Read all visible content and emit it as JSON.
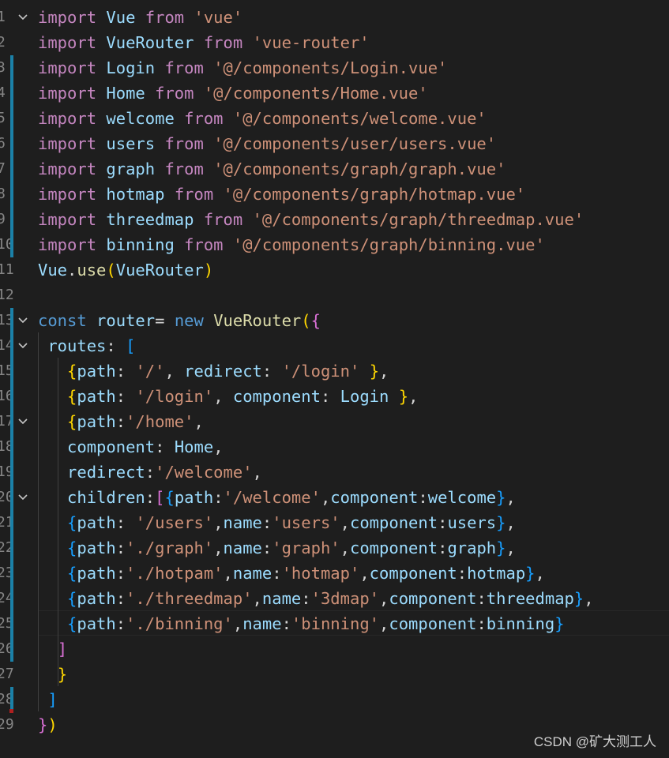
{
  "editor": {
    "lines": [
      {
        "n": "1",
        "fold": true,
        "mark": false,
        "tokens": [
          {
            "t": "import",
            "c": "kw"
          },
          {
            "t": " Vue ",
            "c": "vr"
          },
          {
            "t": "from",
            "c": "kw"
          },
          {
            "t": " ",
            "c": "pu"
          },
          {
            "t": "'vue'",
            "c": "st"
          }
        ]
      },
      {
        "n": "2",
        "fold": false,
        "mark": false,
        "tokens": [
          {
            "t": "import",
            "c": "kw"
          },
          {
            "t": " VueRouter ",
            "c": "vr"
          },
          {
            "t": "from",
            "c": "kw"
          },
          {
            "t": " ",
            "c": "pu"
          },
          {
            "t": "'vue-router'",
            "c": "st"
          }
        ]
      },
      {
        "n": "3",
        "fold": false,
        "mark": true,
        "tokens": [
          {
            "t": "import",
            "c": "kw"
          },
          {
            "t": " Login ",
            "c": "vr"
          },
          {
            "t": "from",
            "c": "kw"
          },
          {
            "t": " ",
            "c": "pu"
          },
          {
            "t": "'@/components/Login.vue'",
            "c": "st"
          }
        ]
      },
      {
        "n": "4",
        "fold": false,
        "mark": true,
        "tokens": [
          {
            "t": "import",
            "c": "kw"
          },
          {
            "t": " Home ",
            "c": "vr"
          },
          {
            "t": "from",
            "c": "kw"
          },
          {
            "t": " ",
            "c": "pu"
          },
          {
            "t": "'@/components/Home.vue'",
            "c": "st"
          }
        ]
      },
      {
        "n": "5",
        "fold": false,
        "mark": true,
        "tokens": [
          {
            "t": "import",
            "c": "kw"
          },
          {
            "t": " welcome ",
            "c": "vr"
          },
          {
            "t": "from",
            "c": "kw"
          },
          {
            "t": " ",
            "c": "pu"
          },
          {
            "t": "'@/components/welcome.vue'",
            "c": "st"
          }
        ]
      },
      {
        "n": "6",
        "fold": false,
        "mark": true,
        "tokens": [
          {
            "t": "import",
            "c": "kw"
          },
          {
            "t": " users ",
            "c": "vr"
          },
          {
            "t": "from",
            "c": "kw"
          },
          {
            "t": " ",
            "c": "pu"
          },
          {
            "t": "'@/components/user/users.vue'",
            "c": "st"
          }
        ]
      },
      {
        "n": "7",
        "fold": false,
        "mark": true,
        "tokens": [
          {
            "t": "import",
            "c": "kw"
          },
          {
            "t": " graph ",
            "c": "vr"
          },
          {
            "t": "from",
            "c": "kw"
          },
          {
            "t": " ",
            "c": "pu"
          },
          {
            "t": "'@/components/graph/graph.vue'",
            "c": "st"
          }
        ]
      },
      {
        "n": "8",
        "fold": false,
        "mark": true,
        "tokens": [
          {
            "t": "import",
            "c": "kw"
          },
          {
            "t": " hotmap ",
            "c": "vr"
          },
          {
            "t": "from",
            "c": "kw"
          },
          {
            "t": " ",
            "c": "pu"
          },
          {
            "t": "'@/components/graph/hotmap.vue'",
            "c": "st"
          }
        ]
      },
      {
        "n": "9",
        "fold": false,
        "mark": true,
        "tokens": [
          {
            "t": "import",
            "c": "kw"
          },
          {
            "t": " threedmap ",
            "c": "vr"
          },
          {
            "t": "from",
            "c": "kw"
          },
          {
            "t": " ",
            "c": "pu"
          },
          {
            "t": "'@/components/graph/threedmap.vue'",
            "c": "st"
          }
        ]
      },
      {
        "n": "10",
        "fold": false,
        "mark": true,
        "tokens": [
          {
            "t": "import",
            "c": "kw"
          },
          {
            "t": " binning ",
            "c": "vr"
          },
          {
            "t": "from",
            "c": "kw"
          },
          {
            "t": " ",
            "c": "pu"
          },
          {
            "t": "'@/components/graph/binning.vue'",
            "c": "st"
          }
        ]
      },
      {
        "n": "11",
        "fold": false,
        "mark": false,
        "tokens": [
          {
            "t": "Vue",
            "c": "vr"
          },
          {
            "t": ".",
            "c": "pu"
          },
          {
            "t": "use",
            "c": "fn"
          },
          {
            "t": "(",
            "c": "br1"
          },
          {
            "t": "VueRouter",
            "c": "vr"
          },
          {
            "t": ")",
            "c": "br1"
          }
        ]
      },
      {
        "n": "12",
        "fold": false,
        "mark": false,
        "tokens": []
      },
      {
        "n": "13",
        "fold": true,
        "mark": true,
        "tokens": [
          {
            "t": "const",
            "c": "kb"
          },
          {
            "t": " router",
            "c": "vr"
          },
          {
            "t": "= ",
            "c": "pu"
          },
          {
            "t": "new",
            "c": "kb"
          },
          {
            "t": " ",
            "c": "pu"
          },
          {
            "t": "VueRouter",
            "c": "fn"
          },
          {
            "t": "(",
            "c": "br1"
          },
          {
            "t": "{",
            "c": "br2"
          }
        ]
      },
      {
        "n": "14",
        "fold": true,
        "mark": true,
        "tokens": [
          {
            "t": " routes",
            "c": "vr"
          },
          {
            "t": ": ",
            "c": "pu"
          },
          {
            "t": "[",
            "c": "br3"
          }
        ]
      },
      {
        "n": "15",
        "fold": false,
        "mark": true,
        "tokens": [
          {
            "t": "   ",
            "c": "pu"
          },
          {
            "t": "{",
            "c": "br1"
          },
          {
            "t": "path",
            "c": "vr"
          },
          {
            "t": ": ",
            "c": "pu"
          },
          {
            "t": "'/'",
            "c": "st"
          },
          {
            "t": ", ",
            "c": "pu"
          },
          {
            "t": "redirect",
            "c": "vr"
          },
          {
            "t": ": ",
            "c": "pu"
          },
          {
            "t": "'/login'",
            "c": "st"
          },
          {
            "t": " ",
            "c": "pu"
          },
          {
            "t": "}",
            "c": "br1"
          },
          {
            "t": ",",
            "c": "pu"
          }
        ]
      },
      {
        "n": "16",
        "fold": false,
        "mark": true,
        "tokens": [
          {
            "t": "   ",
            "c": "pu"
          },
          {
            "t": "{",
            "c": "br1"
          },
          {
            "t": "path",
            "c": "vr"
          },
          {
            "t": ": ",
            "c": "pu"
          },
          {
            "t": "'/login'",
            "c": "st"
          },
          {
            "t": ", ",
            "c": "pu"
          },
          {
            "t": "component",
            "c": "vr"
          },
          {
            "t": ": ",
            "c": "pu"
          },
          {
            "t": "Login",
            "c": "vr"
          },
          {
            "t": " ",
            "c": "pu"
          },
          {
            "t": "}",
            "c": "br1"
          },
          {
            "t": ",",
            "c": "pu"
          }
        ]
      },
      {
        "n": "17",
        "fold": true,
        "mark": true,
        "tokens": [
          {
            "t": "   ",
            "c": "pu"
          },
          {
            "t": "{",
            "c": "br1"
          },
          {
            "t": "path",
            "c": "vr"
          },
          {
            "t": ":",
            "c": "pu"
          },
          {
            "t": "'/home'",
            "c": "st"
          },
          {
            "t": ",",
            "c": "pu"
          }
        ]
      },
      {
        "n": "18",
        "fold": false,
        "mark": true,
        "tokens": [
          {
            "t": "   ",
            "c": "pu"
          },
          {
            "t": "component",
            "c": "vr"
          },
          {
            "t": ": ",
            "c": "pu"
          },
          {
            "t": "Home",
            "c": "vr"
          },
          {
            "t": ",",
            "c": "pu"
          }
        ]
      },
      {
        "n": "19",
        "fold": false,
        "mark": true,
        "tokens": [
          {
            "t": "   ",
            "c": "pu"
          },
          {
            "t": "redirect",
            "c": "vr"
          },
          {
            "t": ":",
            "c": "pu"
          },
          {
            "t": "'/welcome'",
            "c": "st"
          },
          {
            "t": ",",
            "c": "pu"
          }
        ]
      },
      {
        "n": "20",
        "fold": true,
        "mark": true,
        "tokens": [
          {
            "t": "   ",
            "c": "pu"
          },
          {
            "t": "children",
            "c": "vr"
          },
          {
            "t": ":",
            "c": "pu"
          },
          {
            "t": "[",
            "c": "br2"
          },
          {
            "t": "{",
            "c": "br3"
          },
          {
            "t": "path",
            "c": "vr"
          },
          {
            "t": ":",
            "c": "pu"
          },
          {
            "t": "'/welcome'",
            "c": "st"
          },
          {
            "t": ",",
            "c": "pu"
          },
          {
            "t": "component",
            "c": "vr"
          },
          {
            "t": ":",
            "c": "pu"
          },
          {
            "t": "welcome",
            "c": "vr"
          },
          {
            "t": "}",
            "c": "br3"
          },
          {
            "t": ",",
            "c": "pu"
          }
        ]
      },
      {
        "n": "21",
        "fold": false,
        "mark": true,
        "tokens": [
          {
            "t": "   ",
            "c": "pu"
          },
          {
            "t": "{",
            "c": "br3"
          },
          {
            "t": "path",
            "c": "vr"
          },
          {
            "t": ": ",
            "c": "pu"
          },
          {
            "t": "'/users'",
            "c": "st"
          },
          {
            "t": ",",
            "c": "pu"
          },
          {
            "t": "name",
            "c": "vr"
          },
          {
            "t": ":",
            "c": "pu"
          },
          {
            "t": "'users'",
            "c": "st"
          },
          {
            "t": ",",
            "c": "pu"
          },
          {
            "t": "component",
            "c": "vr"
          },
          {
            "t": ":",
            "c": "pu"
          },
          {
            "t": "users",
            "c": "vr"
          },
          {
            "t": "}",
            "c": "br3"
          },
          {
            "t": ",",
            "c": "pu"
          }
        ]
      },
      {
        "n": "22",
        "fold": false,
        "mark": true,
        "tokens": [
          {
            "t": "   ",
            "c": "pu"
          },
          {
            "t": "{",
            "c": "br3"
          },
          {
            "t": "path",
            "c": "vr"
          },
          {
            "t": ":",
            "c": "pu"
          },
          {
            "t": "'./graph'",
            "c": "st"
          },
          {
            "t": ",",
            "c": "pu"
          },
          {
            "t": "name",
            "c": "vr"
          },
          {
            "t": ":",
            "c": "pu"
          },
          {
            "t": "'graph'",
            "c": "st"
          },
          {
            "t": ",",
            "c": "pu"
          },
          {
            "t": "component",
            "c": "vr"
          },
          {
            "t": ":",
            "c": "pu"
          },
          {
            "t": "graph",
            "c": "vr"
          },
          {
            "t": "}",
            "c": "br3"
          },
          {
            "t": ",",
            "c": "pu"
          }
        ]
      },
      {
        "n": "23",
        "fold": false,
        "mark": true,
        "tokens": [
          {
            "t": "   ",
            "c": "pu"
          },
          {
            "t": "{",
            "c": "br3"
          },
          {
            "t": "path",
            "c": "vr"
          },
          {
            "t": ":",
            "c": "pu"
          },
          {
            "t": "'./hotpam'",
            "c": "st"
          },
          {
            "t": ",",
            "c": "pu"
          },
          {
            "t": "name",
            "c": "vr"
          },
          {
            "t": ":",
            "c": "pu"
          },
          {
            "t": "'hotmap'",
            "c": "st"
          },
          {
            "t": ",",
            "c": "pu"
          },
          {
            "t": "component",
            "c": "vr"
          },
          {
            "t": ":",
            "c": "pu"
          },
          {
            "t": "hotmap",
            "c": "vr"
          },
          {
            "t": "}",
            "c": "br3"
          },
          {
            "t": ",",
            "c": "pu"
          }
        ]
      },
      {
        "n": "24",
        "fold": false,
        "mark": true,
        "tokens": [
          {
            "t": "   ",
            "c": "pu"
          },
          {
            "t": "{",
            "c": "br3"
          },
          {
            "t": "path",
            "c": "vr"
          },
          {
            "t": ":",
            "c": "pu"
          },
          {
            "t": "'./threedmap'",
            "c": "st"
          },
          {
            "t": ",",
            "c": "pu"
          },
          {
            "t": "name",
            "c": "vr"
          },
          {
            "t": ":",
            "c": "pu"
          },
          {
            "t": "'3dmap'",
            "c": "st"
          },
          {
            "t": ",",
            "c": "pu"
          },
          {
            "t": "component",
            "c": "vr"
          },
          {
            "t": ":",
            "c": "pu"
          },
          {
            "t": "threedmap",
            "c": "vr"
          },
          {
            "t": "}",
            "c": "br3"
          },
          {
            "t": ",",
            "c": "pu"
          }
        ]
      },
      {
        "n": "25",
        "fold": false,
        "mark": true,
        "tokens": [
          {
            "t": "   ",
            "c": "pu"
          },
          {
            "t": "{",
            "c": "br3"
          },
          {
            "t": "path",
            "c": "vr"
          },
          {
            "t": ":",
            "c": "pu"
          },
          {
            "t": "'./binning'",
            "c": "st"
          },
          {
            "t": ",",
            "c": "pu"
          },
          {
            "t": "name",
            "c": "vr"
          },
          {
            "t": ":",
            "c": "pu"
          },
          {
            "t": "'binning'",
            "c": "st"
          },
          {
            "t": ",",
            "c": "pu"
          },
          {
            "t": "component",
            "c": "vr"
          },
          {
            "t": ":",
            "c": "pu"
          },
          {
            "t": "binning",
            "c": "vr"
          },
          {
            "t": "}",
            "c": "br3"
          }
        ]
      },
      {
        "n": "26",
        "fold": false,
        "mark": true,
        "tokens": [
          {
            "t": "  ",
            "c": "pu"
          },
          {
            "t": "]",
            "c": "br2"
          }
        ]
      },
      {
        "n": "27",
        "fold": false,
        "mark": false,
        "tokens": [
          {
            "t": "  ",
            "c": "pu"
          },
          {
            "t": "}",
            "c": "br1"
          }
        ]
      },
      {
        "n": "28",
        "fold": false,
        "mark": true,
        "tokens": [
          {
            "t": " ",
            "c": "pu"
          },
          {
            "t": "]",
            "c": "br3"
          }
        ]
      },
      {
        "n": "29",
        "fold": false,
        "mark": false,
        "tokens": [
          {
            "t": "}",
            "c": "br2"
          },
          {
            "t": ")",
            "c": "br1"
          }
        ]
      }
    ]
  },
  "watermark": "CSDN @矿大测工人",
  "colors": {
    "background": "#1e1e1e",
    "keyword": "#c586c0",
    "variable": "#9cdcfe",
    "string": "#ce9178",
    "function": "#dcdcaa",
    "gutter_mark": "#1b81a8"
  }
}
